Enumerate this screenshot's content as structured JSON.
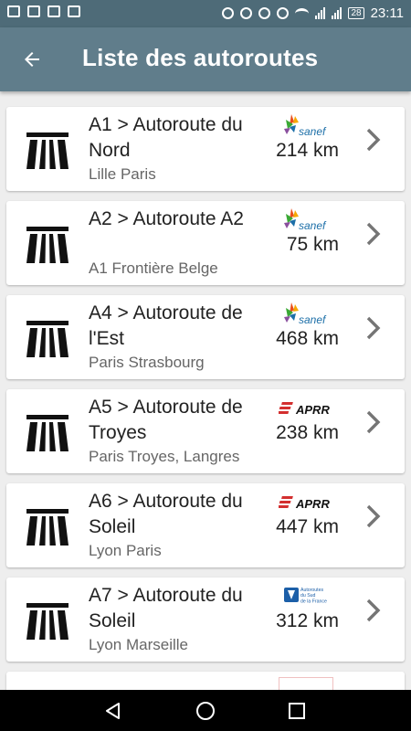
{
  "status_bar": {
    "time": "23:11",
    "battery": "28"
  },
  "app_bar": {
    "title": "Liste des autoroutes",
    "back_icon": "arrow-left-icon"
  },
  "colors": {
    "appbar": "#607d8b",
    "statusbar": "#4e6b78",
    "aprr_red": "#d32f2f",
    "sanef_blue": "#1c6fa8"
  },
  "highways": [
    {
      "name": "A1 > Autoroute du Nord",
      "route": "Lille Paris",
      "distance": "214 km",
      "operator": "sanef",
      "operator_text": "sanef"
    },
    {
      "name": "A2 > Autoroute A2",
      "route": "A1 Frontière Belge",
      "distance": "75 km",
      "operator": "sanef",
      "operator_text": "sanef"
    },
    {
      "name": "A4 > Autoroute de l'Est",
      "route": "Paris Strasbourg",
      "distance": "468 km",
      "operator": "sanef",
      "operator_text": "sanef"
    },
    {
      "name": "A5 > Autoroute de Troyes",
      "route": "Paris Troyes, Langres",
      "distance": "238 km",
      "operator": "aprr",
      "operator_text": "APRR"
    },
    {
      "name": "A6 > Autoroute du Soleil",
      "route": "Lyon Paris",
      "distance": "447 km",
      "operator": "aprr",
      "operator_text": "APRR"
    },
    {
      "name": "A7 > Autoroute du Soleil",
      "route": "Lyon Marseille",
      "distance": "312 km",
      "operator": "asf",
      "operator_text": "Autoroutes du Sud de la France"
    }
  ]
}
